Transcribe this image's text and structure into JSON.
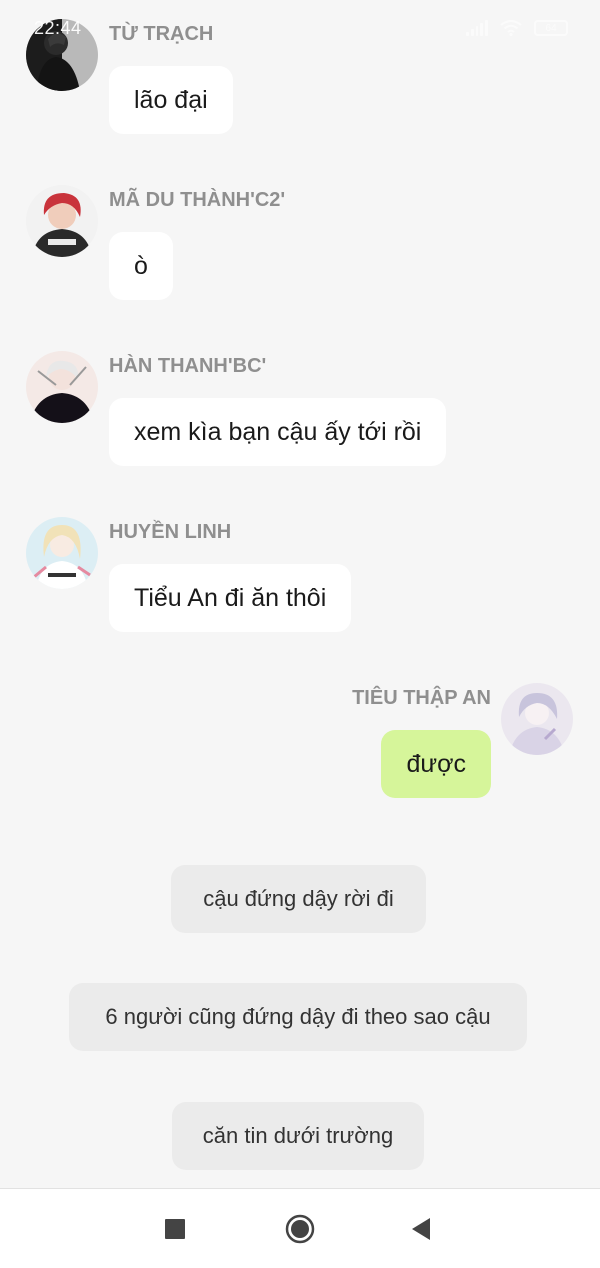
{
  "status_bar": {
    "time": "22:44",
    "battery": "64"
  },
  "messages": [
    {
      "sender": "TỪ TRẠCH",
      "text": "lão đại"
    },
    {
      "sender": "MÃ DU THÀNH'C2'",
      "text": "ò"
    },
    {
      "sender": "HÀN THANH'BC'",
      "text": "xem kìa bạn cậu ấy tới rồi"
    },
    {
      "sender": "HUYỀN LINH",
      "text": "Tiểu An đi ăn thôi"
    },
    {
      "sender": "TIÊU THẬP AN",
      "text": "được",
      "mine": true
    }
  ],
  "system_messages": [
    "cậu đứng dậy rời đi",
    "6 người cũng đứng dậy đi theo sao cậu",
    "căn tin dưới trường"
  ],
  "colors": {
    "background": "#f6f6f6",
    "bubble": "#ffffff",
    "my_bubble": "#d6f59a",
    "system_bubble": "#ebebeb",
    "sender_name": "#8f8f8f"
  },
  "nav_icons": [
    "recent-apps-icon",
    "home-icon",
    "back-icon"
  ]
}
